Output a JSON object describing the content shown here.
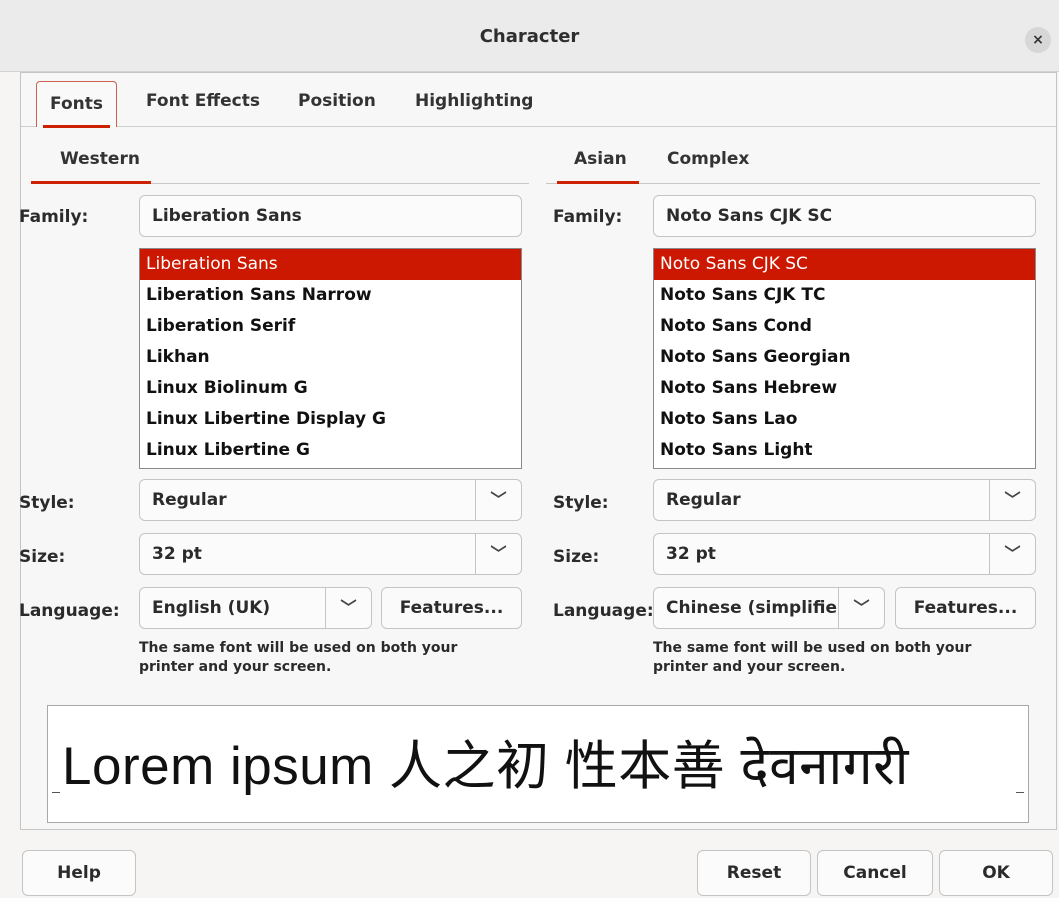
{
  "window": {
    "title": "Character",
    "close_icon": "×"
  },
  "tabs": [
    {
      "label": "Fonts",
      "active": true
    },
    {
      "label": "Font Effects"
    },
    {
      "label": "Position"
    },
    {
      "label": "Highlighting"
    }
  ],
  "western": {
    "tab_label": "Western",
    "family_label": "Family:",
    "family_value": "Liberation Sans",
    "font_list": [
      "Liberation Sans",
      "Liberation Sans Narrow",
      "Liberation Serif",
      "Likhan",
      "Linux Biolinum G",
      "Linux Libertine Display G",
      "Linux Libertine G"
    ],
    "selected_index": 0,
    "style_label": "Style:",
    "style_value": "Regular",
    "size_label": "Size:",
    "size_value": "32 pt",
    "language_label": "Language:",
    "language_value": "English (UK)",
    "features_label": "Features...",
    "note_line1": "The same font will be used on both your",
    "note_line2": "printer and your screen."
  },
  "asian": {
    "tab_label": "Asian",
    "complex_tab_label": "Complex",
    "family_label": "Family:",
    "family_value": "Noto Sans CJK SC",
    "font_list": [
      "Noto Sans CJK SC",
      "Noto Sans CJK TC",
      "Noto Sans Cond",
      "Noto Sans Georgian",
      "Noto Sans Hebrew",
      "Noto Sans Lao",
      "Noto Sans Light"
    ],
    "selected_index": 0,
    "style_label": "Style:",
    "style_value": "Regular",
    "size_label": "Size:",
    "size_value": "32 pt",
    "language_label": "Language:",
    "language_value": "Chinese (simplifie",
    "features_label": "Features...",
    "note_line1": "The same font will be used on both your",
    "note_line2": "printer and your screen."
  },
  "preview": {
    "text": "Lorem ipsum   人之初 性本善   देवनागरी"
  },
  "footer": {
    "help": "Help",
    "reset": "Reset",
    "cancel": "Cancel",
    "ok": "OK"
  },
  "icons": {
    "dropdown_arrow": "﹀",
    "close": "close-icon"
  }
}
